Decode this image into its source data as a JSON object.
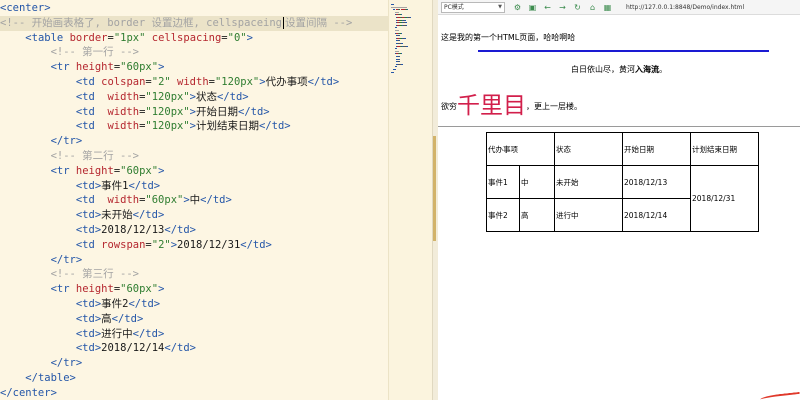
{
  "editor": {
    "lines": [
      [
        {
          "t": "<center>",
          "c": "tag"
        }
      ],
      [
        {
          "t": "<!-- 开始画表格了, border 设置边框, cellspaceing",
          "c": "cmt"
        },
        {
          "t": "",
          "c": "cursor"
        },
        {
          "t": "设置间隔 -->",
          "c": "cmt"
        }
      ],
      [
        {
          "t": "    "
        },
        {
          "t": "<table ",
          "c": "tag"
        },
        {
          "t": "border",
          "c": "attr"
        },
        {
          "t": "=",
          "c": "txt"
        },
        {
          "t": "\"1px\"",
          "c": "str"
        },
        {
          "t": " cellspacing",
          "c": "attr"
        },
        {
          "t": "=",
          "c": "txt"
        },
        {
          "t": "\"0\"",
          "c": "str"
        },
        {
          "t": ">",
          "c": "tag"
        }
      ],
      [
        {
          "t": "        "
        },
        {
          "t": "<!-- 第一行 -->",
          "c": "cmt"
        }
      ],
      [
        {
          "t": "        "
        },
        {
          "t": "<tr ",
          "c": "tag"
        },
        {
          "t": "height",
          "c": "attr"
        },
        {
          "t": "=",
          "c": "txt"
        },
        {
          "t": "\"60px\"",
          "c": "str"
        },
        {
          "t": ">",
          "c": "tag"
        }
      ],
      [
        {
          "t": "            "
        },
        {
          "t": "<td ",
          "c": "tag"
        },
        {
          "t": "colspan",
          "c": "attr"
        },
        {
          "t": "=",
          "c": "txt"
        },
        {
          "t": "\"2\"",
          "c": "str"
        },
        {
          "t": " width",
          "c": "attr"
        },
        {
          "t": "=",
          "c": "txt"
        },
        {
          "t": "\"120px\"",
          "c": "str"
        },
        {
          "t": ">",
          "c": "tag"
        },
        {
          "t": "代办事项",
          "c": "txt"
        },
        {
          "t": "</td>",
          "c": "tag"
        }
      ],
      [
        {
          "t": "            "
        },
        {
          "t": "<td  ",
          "c": "tag"
        },
        {
          "t": "width",
          "c": "attr"
        },
        {
          "t": "=",
          "c": "txt"
        },
        {
          "t": "\"120px\"",
          "c": "str"
        },
        {
          "t": ">",
          "c": "tag"
        },
        {
          "t": "状态",
          "c": "txt"
        },
        {
          "t": "</td>",
          "c": "tag"
        }
      ],
      [
        {
          "t": "            "
        },
        {
          "t": "<td  ",
          "c": "tag"
        },
        {
          "t": "width",
          "c": "attr"
        },
        {
          "t": "=",
          "c": "txt"
        },
        {
          "t": "\"120px\"",
          "c": "str"
        },
        {
          "t": ">",
          "c": "tag"
        },
        {
          "t": "开始日期",
          "c": "txt"
        },
        {
          "t": "</td>",
          "c": "tag"
        }
      ],
      [
        {
          "t": "            "
        },
        {
          "t": "<td  ",
          "c": "tag"
        },
        {
          "t": "width",
          "c": "attr"
        },
        {
          "t": "=",
          "c": "txt"
        },
        {
          "t": "\"120px\"",
          "c": "str"
        },
        {
          "t": ">",
          "c": "tag"
        },
        {
          "t": "计划结束日期",
          "c": "txt"
        },
        {
          "t": "</td>",
          "c": "tag"
        }
      ],
      [
        {
          "t": "        "
        },
        {
          "t": "</tr>",
          "c": "tag"
        }
      ],
      [
        {
          "t": "        "
        },
        {
          "t": "<!-- 第二行 -->",
          "c": "cmt"
        }
      ],
      [
        {
          "t": "        "
        },
        {
          "t": "<tr ",
          "c": "tag"
        },
        {
          "t": "height",
          "c": "attr"
        },
        {
          "t": "=",
          "c": "txt"
        },
        {
          "t": "\"60px\"",
          "c": "str"
        },
        {
          "t": ">",
          "c": "tag"
        }
      ],
      [
        {
          "t": "            "
        },
        {
          "t": "<td>",
          "c": "tag"
        },
        {
          "t": "事件1",
          "c": "txt"
        },
        {
          "t": "</td>",
          "c": "tag"
        }
      ],
      [
        {
          "t": "            "
        },
        {
          "t": "<td  ",
          "c": "tag"
        },
        {
          "t": "width",
          "c": "attr"
        },
        {
          "t": "=",
          "c": "txt"
        },
        {
          "t": "\"60px\"",
          "c": "str"
        },
        {
          "t": ">",
          "c": "tag"
        },
        {
          "t": "中",
          "c": "txt"
        },
        {
          "t": "</td>",
          "c": "tag"
        }
      ],
      [
        {
          "t": "            "
        },
        {
          "t": "<td>",
          "c": "tag"
        },
        {
          "t": "未开始",
          "c": "txt"
        },
        {
          "t": "</td>",
          "c": "tag"
        }
      ],
      [
        {
          "t": "            "
        },
        {
          "t": "<td>",
          "c": "tag"
        },
        {
          "t": "2018/12/13",
          "c": "txt"
        },
        {
          "t": "</td>",
          "c": "tag"
        }
      ],
      [
        {
          "t": "            "
        },
        {
          "t": "<td ",
          "c": "tag"
        },
        {
          "t": "rowspan",
          "c": "attr"
        },
        {
          "t": "=",
          "c": "txt"
        },
        {
          "t": "\"2\"",
          "c": "str"
        },
        {
          "t": ">",
          "c": "tag"
        },
        {
          "t": "2018/12/31",
          "c": "txt"
        },
        {
          "t": "</td>",
          "c": "tag"
        }
      ],
      [
        {
          "t": "        "
        },
        {
          "t": "</tr>",
          "c": "tag"
        }
      ],
      [
        {
          "t": "        "
        },
        {
          "t": "<!-- 第三行 -->",
          "c": "cmt"
        }
      ],
      [
        {
          "t": "        "
        },
        {
          "t": "<tr ",
          "c": "tag"
        },
        {
          "t": "height",
          "c": "attr"
        },
        {
          "t": "=",
          "c": "txt"
        },
        {
          "t": "\"60px\"",
          "c": "str"
        },
        {
          "t": ">",
          "c": "tag"
        }
      ],
      [
        {
          "t": "            "
        },
        {
          "t": "<td>",
          "c": "tag"
        },
        {
          "t": "事件2",
          "c": "txt"
        },
        {
          "t": "</td>",
          "c": "tag"
        }
      ],
      [
        {
          "t": "            "
        },
        {
          "t": "<td>",
          "c": "tag"
        },
        {
          "t": "高",
          "c": "txt"
        },
        {
          "t": "</td>",
          "c": "tag"
        }
      ],
      [
        {
          "t": "            "
        },
        {
          "t": "<td>",
          "c": "tag"
        },
        {
          "t": "进行中",
          "c": "txt"
        },
        {
          "t": "</td>",
          "c": "tag"
        }
      ],
      [
        {
          "t": "            "
        },
        {
          "t": "<td>",
          "c": "tag"
        },
        {
          "t": "2018/12/14",
          "c": "txt"
        },
        {
          "t": "</td>",
          "c": "tag"
        }
      ],
      [
        {
          "t": "        "
        },
        {
          "t": "</tr>",
          "c": "tag"
        }
      ],
      [
        {
          "t": "    "
        },
        {
          "t": "</table>",
          "c": "tag"
        }
      ],
      [
        {
          "t": "</center>",
          "c": "tag"
        }
      ]
    ]
  },
  "browser": {
    "mode": "PC模式",
    "url": "http://127.0.0.1:8848/Demo/index.html",
    "icons": [
      "settings-icon",
      "screenshot-icon",
      "back-icon",
      "forward-icon",
      "refresh-icon",
      "lock-icon",
      "qrcode-icon"
    ]
  },
  "page": {
    "intro": "这是我的第一个HTML页面，哈哈啊哈",
    "poem1_normal": "白日依山尽，黄河",
    "poem1_bold": "入海流",
    "poem1_end": "。",
    "poem2_start": "欲穷",
    "poem2_big": "千里目",
    "poem2_end": "，更上一层楼。",
    "table": {
      "headers": [
        "代办事项",
        "状态",
        "开始日期",
        "计划结束日期"
      ],
      "rows": [
        {
          "event": "事件1",
          "priority": "中",
          "status": "未开始",
          "start": "2018/12/13"
        },
        {
          "event": "事件2",
          "priority": "高",
          "status": "进行中",
          "start": "2018/12/14"
        }
      ],
      "end_date": "2018/12/31"
    }
  },
  "colors": {
    "editor_bg": "#fdf6e3",
    "tag": "#2456a8",
    "attr": "#b5272f",
    "string": "#2f7d30",
    "comment": "#a3a3a3",
    "blue_rule": "#1a1ad2",
    "big_text": "#d21f4b"
  }
}
